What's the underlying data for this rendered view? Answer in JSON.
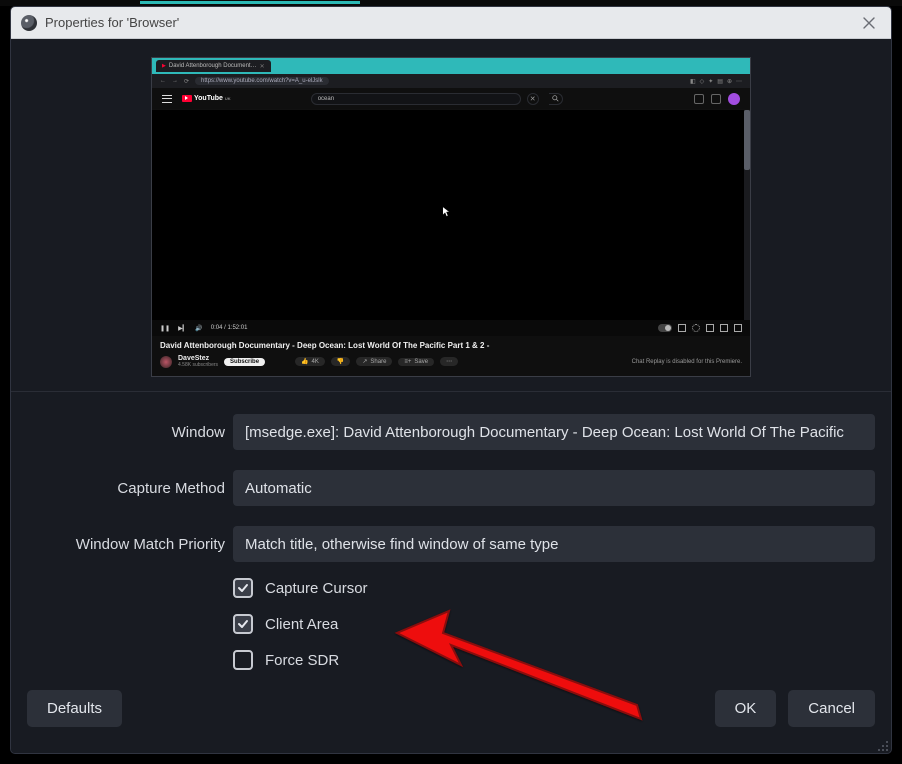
{
  "titlebar": {
    "title": "Properties for 'Browser'"
  },
  "preview": {
    "tab_label": "David Attenborough Document…",
    "url": "https://www.youtube.com/watch?v=A_u-elJslk",
    "search_value": "ocean",
    "timecode": "0:04 / 1:52:01",
    "video_title": "David Attenborough Documentary - Deep Ocean: Lost World Of The Pacific Part 1 & 2 -",
    "channel_name": "DaveStez",
    "channel_sub": "4.58K subscribers",
    "subscribe": "Subscribe",
    "like_count": "4K",
    "share": "Share",
    "save": "Save",
    "chat_note": "Chat Replay is disabled for this Premiere."
  },
  "form": {
    "window_label": "Window",
    "window_value": "[msedge.exe]: David Attenborough Documentary - Deep Ocean: Lost World Of The Pacific",
    "capture_method_label": "Capture Method",
    "capture_method_value": "Automatic",
    "match_priority_label": "Window Match Priority",
    "match_priority_value": "Match title, otherwise find window of same type",
    "capture_cursor": "Capture Cursor",
    "client_area": "Client Area",
    "force_sdr": "Force SDR"
  },
  "footer": {
    "defaults": "Defaults",
    "ok": "OK",
    "cancel": "Cancel"
  }
}
